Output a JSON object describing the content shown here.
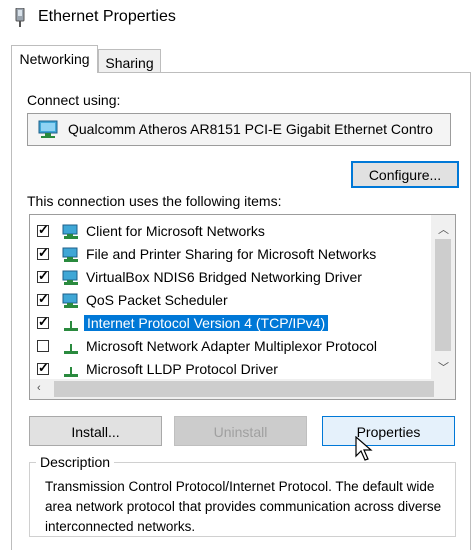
{
  "window": {
    "title": "Ethernet Properties"
  },
  "tabs": [
    {
      "label": "Networking",
      "active": true
    },
    {
      "label": "Sharing",
      "active": false
    }
  ],
  "connect_using": {
    "label": "Connect using:",
    "adapter_name": "Qualcomm Atheros AR8151 PCI-E Gigabit Ethernet Contro",
    "adapter_icon": "network-adapter-icon"
  },
  "buttons": {
    "configure": "Configure...",
    "install": "Install...",
    "uninstall": "Uninstall",
    "properties": "Properties"
  },
  "items_label": "This connection uses the following items:",
  "items": [
    {
      "label": "Client for Microsoft Networks",
      "checked": true,
      "icon": "network-client-icon"
    },
    {
      "label": "File and Printer Sharing for Microsoft Networks",
      "checked": true,
      "icon": "network-service-icon"
    },
    {
      "label": "VirtualBox NDIS6 Bridged Networking Driver",
      "checked": true,
      "icon": "network-service-icon"
    },
    {
      "label": "QoS Packet Scheduler",
      "checked": true,
      "icon": "network-service-icon"
    },
    {
      "label": "Internet Protocol Version 4 (TCP/IPv4)",
      "checked": true,
      "selected": true,
      "icon": "protocol-icon"
    },
    {
      "label": "Microsoft Network Adapter Multiplexor Protocol",
      "checked": false,
      "icon": "protocol-icon"
    },
    {
      "label": "Microsoft LLDP Protocol Driver",
      "checked": true,
      "icon": "protocol-icon"
    }
  ],
  "description": {
    "title": "Description",
    "text": "Transmission Control Protocol/Internet Protocol. The default wide area network protocol that provides communication across diverse interconnected networks."
  },
  "colors": {
    "selection": "#0078d7",
    "accent_border": "#0078d7"
  }
}
